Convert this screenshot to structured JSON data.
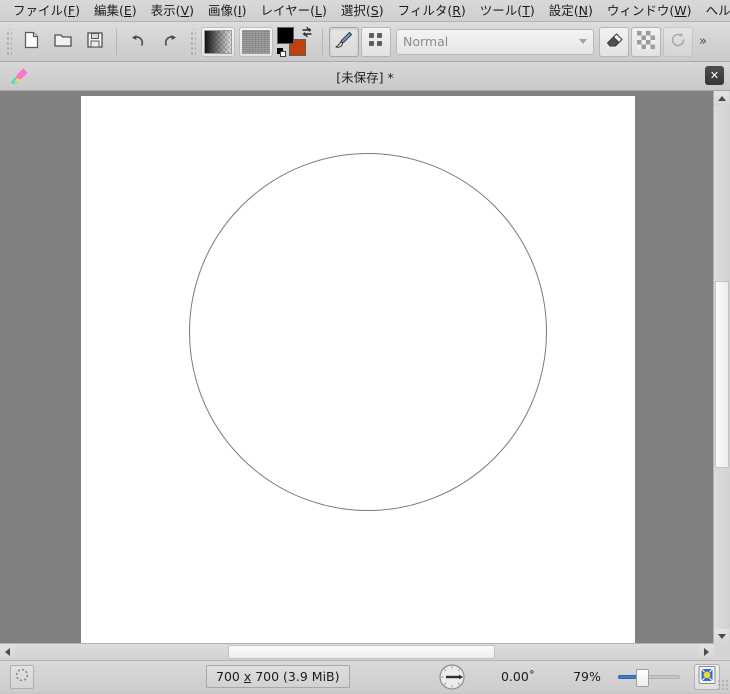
{
  "menubar": {
    "items": [
      {
        "label": "ファイル(F)",
        "mnemonic": "F"
      },
      {
        "label": "編集(E)",
        "mnemonic": "E"
      },
      {
        "label": "表示(V)",
        "mnemonic": "V"
      },
      {
        "label": "画像(I)",
        "mnemonic": "I"
      },
      {
        "label": "レイヤー(L)",
        "mnemonic": "L"
      },
      {
        "label": "選択(S)",
        "mnemonic": "S"
      },
      {
        "label": "フィルタ(R)",
        "mnemonic": "R"
      },
      {
        "label": "ツール(T)",
        "mnemonic": "T"
      },
      {
        "label": "設定(N)",
        "mnemonic": "N"
      },
      {
        "label": "ウィンドウ(W)",
        "mnemonic": "W"
      },
      {
        "label": "ヘルプ(H)",
        "mnemonic": "H"
      }
    ]
  },
  "toolbar": {
    "new_icon": "new-document-icon",
    "open_icon": "open-folder-icon",
    "save_icon": "save-floppy-icon",
    "undo_icon": "undo-arrow-icon",
    "redo_icon": "redo-arrow-icon",
    "gradient_icon": "gradient-swatch-icon",
    "pattern_icon": "pattern-swatch-icon",
    "foreground_color": "#000000",
    "background_color": "#c0430f",
    "swap_icon": "swap-colors-icon",
    "reset_icon": "reset-colors-icon",
    "brush_tool_icon": "paintbrush-icon",
    "brush_select_icon": "brush-grid-icon",
    "blend_mode": "Normal",
    "blend_mode_dropdown_icon": "chevron-down-icon",
    "eraser_icon": "eraser-icon",
    "transparency_icon": "checkerboard-icon",
    "rotate_icon": "rotate-refresh-icon",
    "overflow_label": "»"
  },
  "titlebar": {
    "app_icon": "brush-app-icon",
    "title": "[未保存] *",
    "close_label": "✕"
  },
  "canvas": {
    "shape": "circle-outline",
    "shape_stroke_color": "#7b7b7b",
    "sheet_color": "#ffffff",
    "workspace_color": "#808080"
  },
  "scrollbars": {
    "vertical_up_icon": "scroll-up-arrow-icon",
    "vertical_down_icon": "scroll-down-arrow-icon",
    "horizontal_left_icon": "scroll-left-arrow-icon",
    "horizontal_right_icon": "scroll-right-arrow-icon"
  },
  "statusbar": {
    "selection_icon": "marching-ants-selection-icon",
    "image_size": "700 x 700 (3.9 MiB)",
    "rotation_icon": "rotation-dial-icon",
    "angle": "0.00˚",
    "zoom": "79%",
    "zoom_slider_icon": "zoom-slider",
    "fit_image_icon": "fit-image-in-window-icon"
  }
}
